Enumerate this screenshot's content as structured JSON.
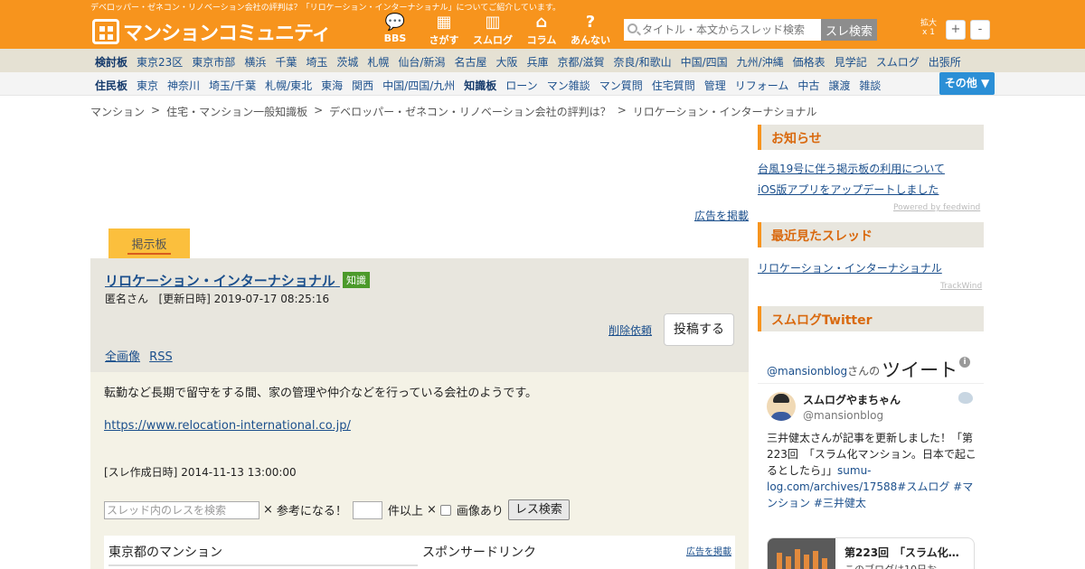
{
  "header": {
    "tagline": "デベロッパー・ゼネコン・リノベーション会社の評判は？「リロケーション・インターナショナル」についてご紹介しています。",
    "logo_text": "マンションコミュニティ",
    "nav": [
      {
        "label": "BBS",
        "icon": "speech-bubble-icon",
        "glyph": "💬"
      },
      {
        "label": "さがす",
        "icon": "building-icon",
        "glyph": "▦"
      },
      {
        "label": "スムログ",
        "icon": "city-icon",
        "glyph": "▥"
      },
      {
        "label": "コラム",
        "icon": "house-icon",
        "glyph": "⌂"
      },
      {
        "label": "あんない",
        "icon": "question-icon",
        "glyph": "?"
      }
    ],
    "search_placeholder": "タイトル・本文からスレッド検索",
    "search_button": "スレ検索",
    "zoom_label_top": "拡大",
    "zoom_label_bottom": "x 1",
    "zoom_in": "+",
    "zoom_out": "-"
  },
  "nav_row1": [
    "検討板",
    "東京23区",
    "東京市部",
    "横浜",
    "千葉",
    "埼玉",
    "茨城",
    "札幌",
    "仙台/新潟",
    "名古屋",
    "大阪",
    "兵庫",
    "京都/滋賀",
    "奈良/和歌山",
    "中国/四国",
    "九州/沖縄",
    "価格表",
    "見学記",
    "スムログ",
    "出張所"
  ],
  "nav_row2": [
    "住民板",
    "東京",
    "神奈川",
    "埼玉/千葉",
    "札幌/東北",
    "東海",
    "関西",
    "中国/四国/九州",
    "知識板",
    "ローン",
    "マン雑談",
    "マン質問",
    "住宅質問",
    "管理",
    "リフォーム",
    "中古",
    "譲渡",
    "雑談"
  ],
  "other_button": "その他 ▼",
  "breadcrumb": [
    "マンション",
    ">",
    "住宅・マンション一般知識板",
    ">",
    "デベロッパー・ゼネコン・リノベーション会社の評判は？",
    ">",
    "リロケーション・インターナショナル"
  ],
  "ad_link": "広告を掲載",
  "tab_label": "掲示板",
  "thread": {
    "title": "リロケーション・インターナショナル",
    "badge": "知識",
    "author": "匿名さん",
    "updated_label": "[更新日時]",
    "updated": "2019-07-17 08:25:16",
    "delete_link": "削除依頼",
    "post_button": "投稿する",
    "links": [
      "全画像",
      "RSS"
    ],
    "body": "転勤など長期で留守をする間、家の管理や仲介などを行っている会社のようです。",
    "url": "https://www.relocation-international.co.jp/",
    "created_label": "[スレ作成日時]",
    "created": "2014-11-13 13:00:00"
  },
  "filter": {
    "placeholder": "スレッド内のレスを検索",
    "sep": "×",
    "helpful": "参考になる！",
    "more_than": "件以上",
    "image": "画像あり",
    "button": "レス検索"
  },
  "box": {
    "left": "東京都のマンション",
    "mid": "スポンサードリンク",
    "right": "広告を掲載"
  },
  "sidebar": {
    "notice_title": "お知らせ",
    "notices": [
      "台風19号に伴う掲示板の利用について",
      "iOS版アプリをアップデートしました"
    ],
    "powered": "Powered by feedwind",
    "recent_title": "最近見たスレッド",
    "recent": [
      "リロケーション・インターナショナル"
    ],
    "trackwind": "TrackWind",
    "twitter_title": "スムログTwitter"
  },
  "twitter": {
    "handle": "@mansionblog",
    "handle_suffix": "さんの",
    "tweets_word": "ツイート",
    "name": "スムログやまちゃん",
    "at": "@mansionblog",
    "text_plain": "三井健太さんが記事を更新しました！「第223回　「スラム化マンション。日本で起こるとしたら」」",
    "text_link": "sumu-log.com/archives/17588",
    "hashtags": "#スムログ #マンション #三井健太",
    "card_title": "第223回　「スラム化…",
    "card_sub": "このブログは10日お…"
  },
  "colors": {
    "brand_orange": "#f7941d",
    "link_blue": "#1b4f8c",
    "other_button_blue": "#2b8fd6",
    "badge_green": "#4c9a2a"
  }
}
